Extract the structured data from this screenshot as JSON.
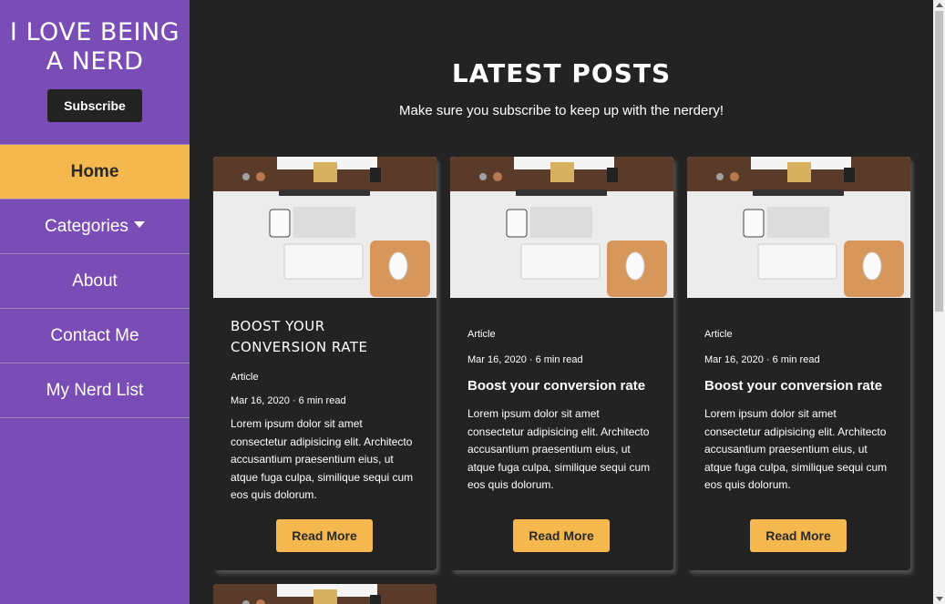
{
  "sidebar": {
    "brand": "I LOVE BEING A NERD",
    "subscribe_label": "Subscribe",
    "nav": [
      {
        "label": "Home",
        "active": true
      },
      {
        "label": "Categories",
        "has_dropdown": true
      },
      {
        "label": "About"
      },
      {
        "label": "Contact Me"
      },
      {
        "label": "My Nerd List"
      }
    ]
  },
  "main": {
    "title": "LATEST POSTS",
    "subtitle": "Make sure you subscribe to keep up with the nerdery!",
    "cards": [
      {
        "title": "BOOST YOUR CONVERSION RATE",
        "tag": "Article",
        "meta": "Mar 16, 2020 · 6 min read",
        "excerpt": "Lorem ipsum dolor sit amet consectetur adipisicing elit. Architecto accusantium praesentium eius, ut atque fuga culpa, similique sequi cum eos quis dolorum.",
        "button": "Read More"
      },
      {
        "tag": "Article",
        "meta": "Mar 16, 2020 · 6 min read",
        "title": "Boost your conversion rate",
        "excerpt": "Lorem ipsum dolor sit amet consectetur adipisicing elit. Architecto accusantium praesentium eius, ut atque fuga culpa, similique sequi cum eos quis dolorum.",
        "button": "Read More"
      },
      {
        "tag": "Article",
        "meta": "Mar 16, 2020 · 6 min read",
        "title": "Boost your conversion rate",
        "excerpt": "Lorem ipsum dolor sit amet consectetur adipisicing elit. Architecto accusantium praesentium eius, ut atque fuga culpa, similique sequi cum eos quis dolorum.",
        "button": "Read More"
      }
    ]
  },
  "colors": {
    "sidebar": "#7a4cb6",
    "accent": "#f4b84e",
    "background": "#232323"
  },
  "icons": {
    "dropdown": "caret-down-icon"
  }
}
